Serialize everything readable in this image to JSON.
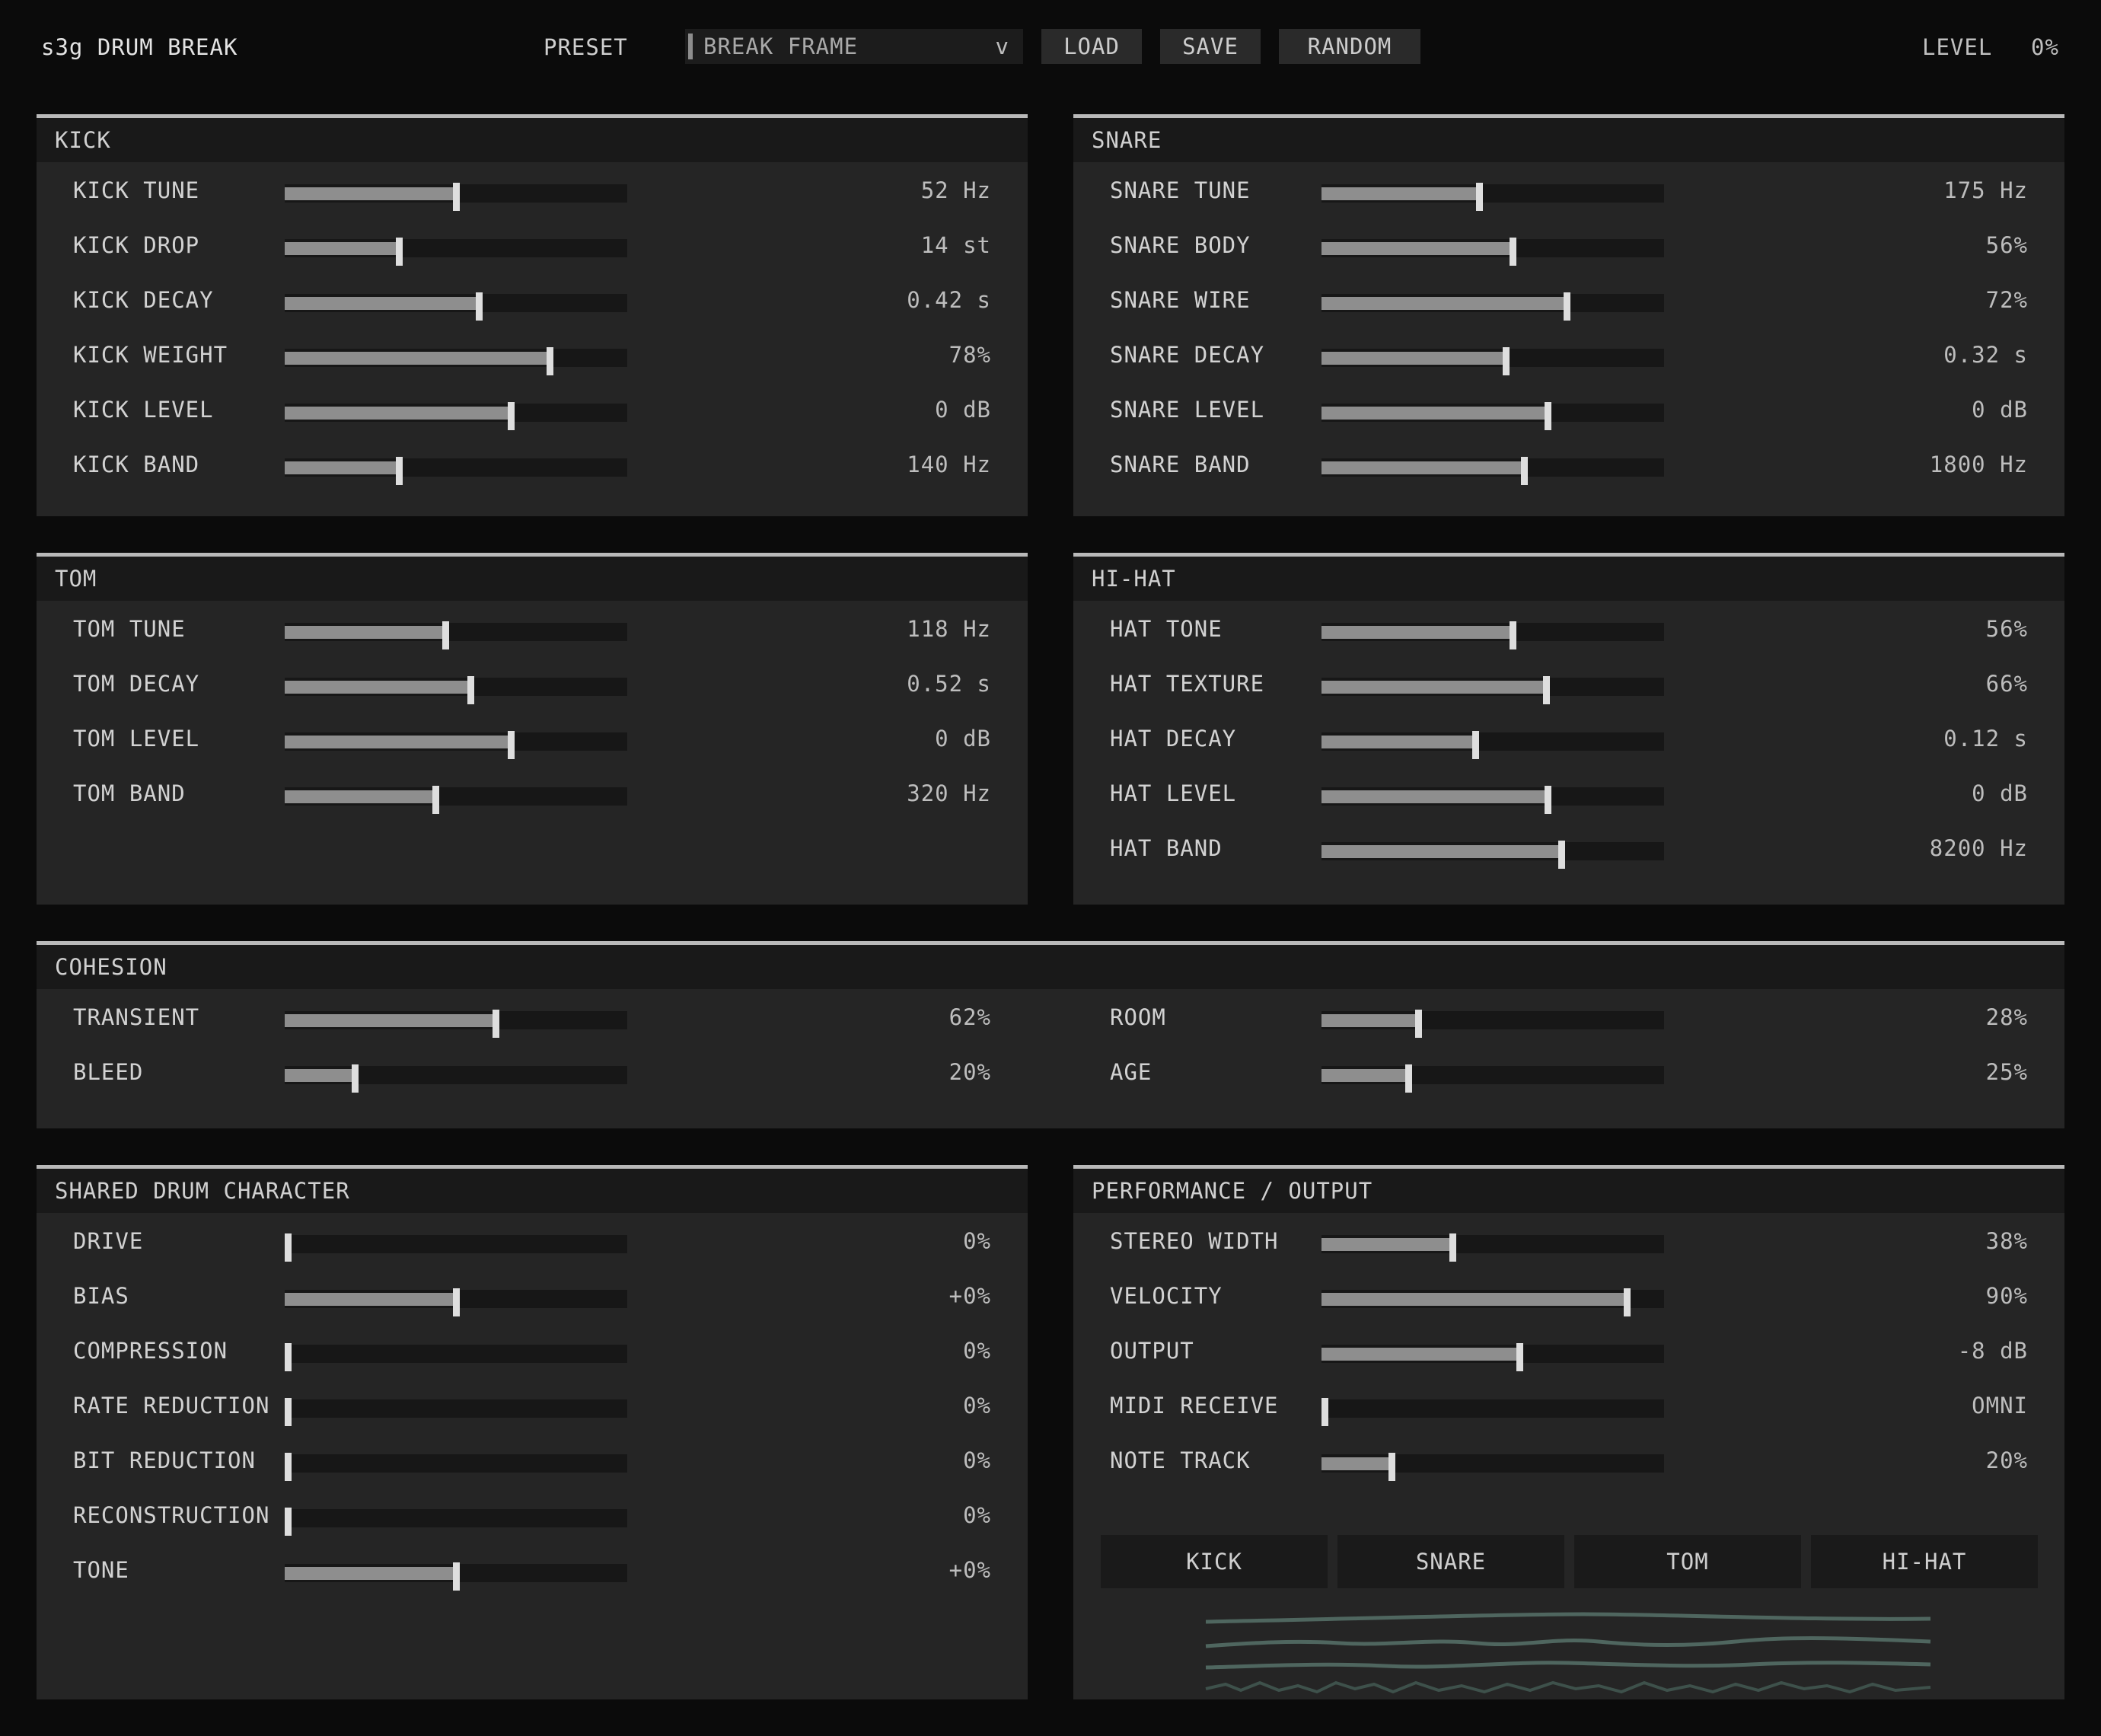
{
  "header": {
    "title": "s3g DRUM BREAK",
    "preset_label": "PRESET",
    "preset_value": "BREAK FRAME",
    "preset_chevron": "v",
    "load_label": "LOAD",
    "save_label": "SAVE",
    "random_label": "RANDOM",
    "level_label": "LEVEL",
    "level_value": "0%"
  },
  "panels": {
    "kick": {
      "title": "KICK",
      "controls": [
        {
          "label": "KICK TUNE",
          "value": "52 Hz",
          "level": 0.5
        },
        {
          "label": "KICK DROP",
          "value": "14 st",
          "level": 0.33
        },
        {
          "label": "KICK DECAY",
          "value": "0.42 s",
          "level": 0.57
        },
        {
          "label": "KICK WEIGHT",
          "value": "78%",
          "level": 0.78
        },
        {
          "label": "KICK LEVEL",
          "value": "0 dB",
          "level": 0.665
        },
        {
          "label": "KICK BAND",
          "value": "140 Hz",
          "level": 0.33
        }
      ]
    },
    "snare": {
      "title": "SNARE",
      "controls": [
        {
          "label": "SNARE TUNE",
          "value": "175 Hz",
          "level": 0.46
        },
        {
          "label": "SNARE BODY",
          "value": "56%",
          "level": 0.56
        },
        {
          "label": "SNARE WIRE",
          "value": "72%",
          "level": 0.72
        },
        {
          "label": "SNARE DECAY",
          "value": "0.32 s",
          "level": 0.54
        },
        {
          "label": "SNARE LEVEL",
          "value": "0 dB",
          "level": 0.665
        },
        {
          "label": "SNARE BAND",
          "value": "1800 Hz",
          "level": 0.595
        }
      ]
    },
    "tom": {
      "title": "TOM",
      "controls": [
        {
          "label": "TOM TUNE",
          "value": "118 Hz",
          "level": 0.47
        },
        {
          "label": "TOM DECAY",
          "value": "0.52 s",
          "level": 0.545
        },
        {
          "label": "TOM LEVEL",
          "value": "0 dB",
          "level": 0.665
        },
        {
          "label": "TOM BAND",
          "value": "320 Hz",
          "level": 0.44
        }
      ]
    },
    "hihat": {
      "title": "HI-HAT",
      "controls": [
        {
          "label": "HAT TONE",
          "value": "56%",
          "level": 0.56
        },
        {
          "label": "HAT TEXTURE",
          "value": "66%",
          "level": 0.66
        },
        {
          "label": "HAT DECAY",
          "value": "0.12 s",
          "level": 0.45
        },
        {
          "label": "HAT LEVEL",
          "value": "0 dB",
          "level": 0.665
        },
        {
          "label": "HAT BAND",
          "value": "8200 Hz",
          "level": 0.705
        }
      ]
    },
    "cohesion": {
      "title": "COHESION",
      "left": [
        {
          "label": "TRANSIENT",
          "value": "62%",
          "level": 0.62
        },
        {
          "label": "BLEED",
          "value": "20%",
          "level": 0.2
        }
      ],
      "right": [
        {
          "label": "ROOM",
          "value": "28%",
          "level": 0.28
        },
        {
          "label": "AGE",
          "value": "25%",
          "level": 0.25
        }
      ]
    },
    "character": {
      "title": "SHARED DRUM CHARACTER",
      "controls": [
        {
          "label": "DRIVE",
          "value": "0%",
          "level": 0.0
        },
        {
          "label": "BIAS",
          "value": "+0%",
          "level": 0.5
        },
        {
          "label": "COMPRESSION",
          "value": "0%",
          "level": 0.0
        },
        {
          "label": "RATE REDUCTION",
          "value": "0%",
          "level": 0.0
        },
        {
          "label": "BIT REDUCTION",
          "value": "0%",
          "level": 0.0
        },
        {
          "label": "RECONSTRUCTION",
          "value": "0%",
          "level": 0.0
        },
        {
          "label": "TONE",
          "value": "+0%",
          "level": 0.5
        }
      ]
    },
    "performance": {
      "title": "PERFORMANCE / OUTPUT",
      "controls": [
        {
          "label": "STEREO WIDTH",
          "value": "38%",
          "level": 0.38
        },
        {
          "label": "VELOCITY",
          "value": "90%",
          "level": 0.9
        },
        {
          "label": "OUTPUT",
          "value": "-8 dB",
          "level": 0.58
        },
        {
          "label": "MIDI RECEIVE",
          "value": "OMNI",
          "level": 0.0
        },
        {
          "label": "NOTE TRACK",
          "value": "20%",
          "level": 0.2
        }
      ],
      "voices": [
        "KICK",
        "SNARE",
        "TOM",
        "HI-HAT"
      ]
    }
  },
  "colors": {
    "background": "#0b0b0b",
    "panel": "#252525",
    "panel_header": "#191919",
    "slider_fill": "#8e8e8e",
    "slider_thumb": "#dedede",
    "wave": "#4f665f"
  }
}
